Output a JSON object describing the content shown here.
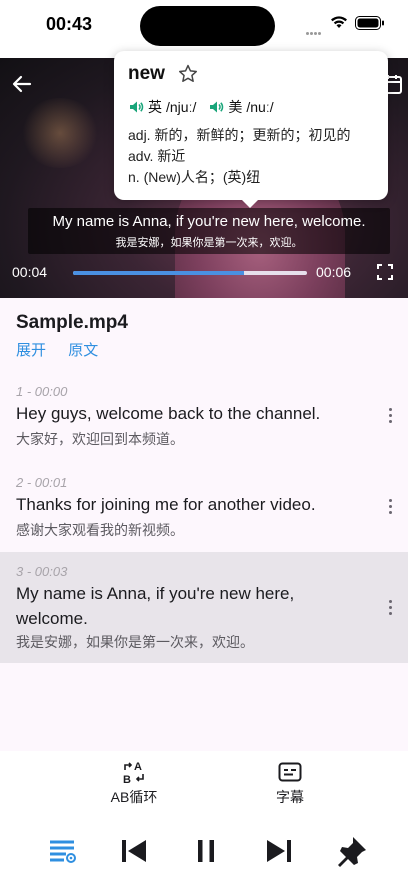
{
  "status_bar": {
    "time": "00:43"
  },
  "video": {
    "subtitle_en": "My name is Anna, if you're new here, welcome.",
    "subtitle_zh": "我是安娜，如果你是第一次来，欢迎。",
    "current_time": "00:04",
    "duration": "00:06",
    "progress": 0.73
  },
  "dictionary": {
    "word": "new",
    "uk_label": "英",
    "uk_phonetic": "/njuː/",
    "us_label": "美",
    "us_phonetic": "/nuː/",
    "definitions": [
      "adj. 新的，新鲜的；更新的；初见的",
      "adv. 新近",
      "n. (New)人名；(英)纽"
    ]
  },
  "file": {
    "title": "Sample.mp4",
    "expand_label": "展开",
    "original_label": "原文"
  },
  "transcript": [
    {
      "meta": "1 - 00:00",
      "en": "Hey guys, welcome back to the channel.",
      "zh": "大家好，欢迎回到本频道。"
    },
    {
      "meta": "2 - 00:01",
      "en": "Thanks for joining me for another video.",
      "zh": "感谢大家观看我的新视频。"
    },
    {
      "meta": "3 - 00:03",
      "en": "My name is Anna, if you're new here, welcome.",
      "zh": "我是安娜，如果你是第一次来，欢迎。"
    }
  ],
  "tools": {
    "ab_loop_label": "AB循环",
    "subtitle_label": "字幕"
  },
  "colors": {
    "accent": "#2f8fe0",
    "progress": "#4a90e2",
    "speaker": "#1aa57a",
    "active_row": "#e8e4ea"
  }
}
